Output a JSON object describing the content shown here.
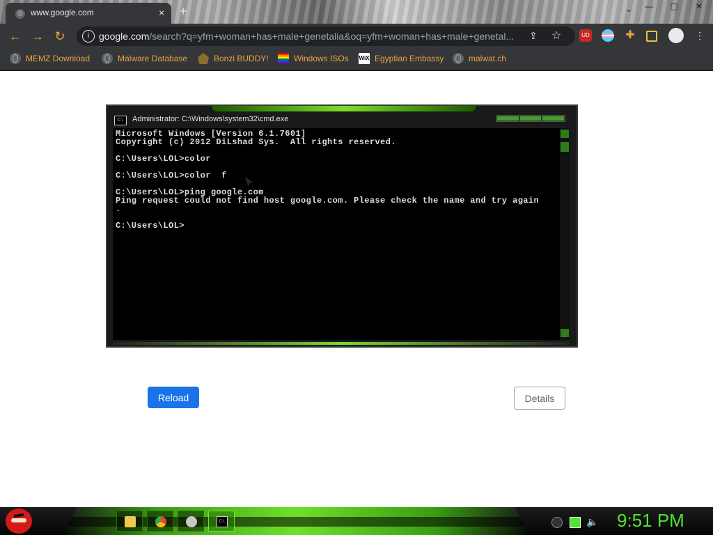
{
  "browser": {
    "tab": {
      "title": "www.google.com",
      "close": "×"
    },
    "new_tab": "+",
    "window_controls": [
      "—",
      "▢",
      "✕"
    ],
    "tab_dropdown": "⌄",
    "nav": {
      "back": "←",
      "forward": "→",
      "reload": "↻"
    },
    "omnibox": {
      "host": "google.com",
      "path": "/search?q=yfm+woman+has+male+genetalia&oq=yfm+woman+has+male+genetal...",
      "info_icon": "i",
      "share_icon": "⇪",
      "star_icon": "☆"
    },
    "extensions": [
      {
        "name": "ublock-icon",
        "label": "UD",
        "color": "#c62828"
      },
      {
        "name": "trans-flag-icon",
        "label": "",
        "color": "#f5a9b8"
      },
      {
        "name": "puzzle-icon",
        "label": "",
        "color": "#e8a33d"
      },
      {
        "name": "sidepanel-icon",
        "label": "",
        "color": "#e8c33d"
      },
      {
        "name": "profile-icon",
        "label": "",
        "color": "#e8eaed"
      }
    ],
    "bookmarks": [
      {
        "label": "MEMZ Download",
        "icon": "globe"
      },
      {
        "label": "Malware Database",
        "icon": "globe"
      },
      {
        "label": "Bonzi BUDDY!",
        "icon": "bonzi"
      },
      {
        "label": "Windows ISOs",
        "icon": "rainbow"
      },
      {
        "label": "Egyptian Embassy",
        "icon": "wix",
        "icon_text": "WiX"
      },
      {
        "label": "malwat.ch",
        "icon": "globe"
      }
    ]
  },
  "page": {
    "cmd_window": {
      "title": "Administrator: C:\\Windows\\system32\\cmd.exe",
      "icon_text": "C:\\.",
      "lines": [
        "Microsoft Windows [Version 6.1.7601]",
        "Copyright (c) 2012 DiLshad Sys.  All rights reserved.",
        "",
        "C:\\Users\\LOL>color",
        "",
        "C:\\Users\\LOL>color  f",
        "",
        "C:\\Users\\LOL>ping google.com",
        "Ping request could not find host google.com. Please check the name and try again",
        ".",
        "",
        "C:\\Users\\LOL>"
      ]
    },
    "reload_label": "Reload",
    "details_label": "Details"
  },
  "taskbar": {
    "clock": "9:51 PM",
    "pinned": [
      {
        "name": "file-explorer-icon",
        "color": "#f2c94c"
      },
      {
        "name": "chrome-icon",
        "color": "#4285f4"
      },
      {
        "name": "paint-icon",
        "color": "#b0b0b0"
      },
      {
        "name": "cmd-icon",
        "color": "#000000",
        "active": true
      }
    ]
  }
}
